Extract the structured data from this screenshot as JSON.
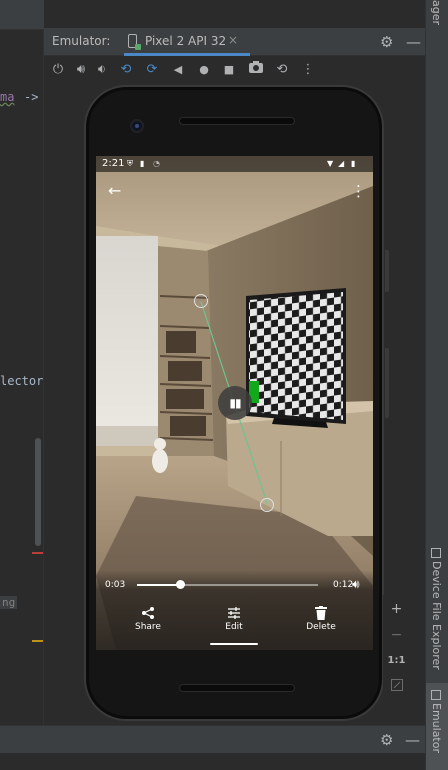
{
  "editor": {
    "code_fragment_1": "ma",
    "code_fragment_2": "->",
    "code_fragment_3": "lector",
    "code_fragment_4": "ng"
  },
  "emulator": {
    "panel_title": "Emulator:",
    "device_tab_label": "Pixel 2 API 32",
    "tab_close_glyph": "×",
    "toolbar_icons": [
      "power-icon",
      "volume-up-icon",
      "volume-down-icon",
      "rotate-left-icon",
      "rotate-right-icon",
      "back-icon",
      "home-icon",
      "overview-icon",
      "screenshot-icon",
      "snapshot-icon",
      "more-icon"
    ]
  },
  "right_strip": {
    "top_label": "ager",
    "device_file_explorer_label": "Device File Explorer",
    "emulator_label": "Emulator"
  },
  "phone": {
    "status_time": "2:21",
    "video": {
      "current_time": "0:03",
      "duration": "0:12",
      "progress_fraction": 0.24
    },
    "actions": [
      {
        "label": "Share",
        "icon": "share-icon"
      },
      {
        "label": "Edit",
        "icon": "edit-sliders-icon"
      },
      {
        "label": "Delete",
        "icon": "trash-icon"
      }
    ]
  },
  "zoom": {
    "zoom_in": "+",
    "zoom_out": "−",
    "actual_size": "1:1"
  },
  "colors": {
    "ide_background": "#2b2b2b",
    "ide_panel": "#3c3f41",
    "tab_accent": "#4a88c7",
    "device_body": "#151515"
  }
}
